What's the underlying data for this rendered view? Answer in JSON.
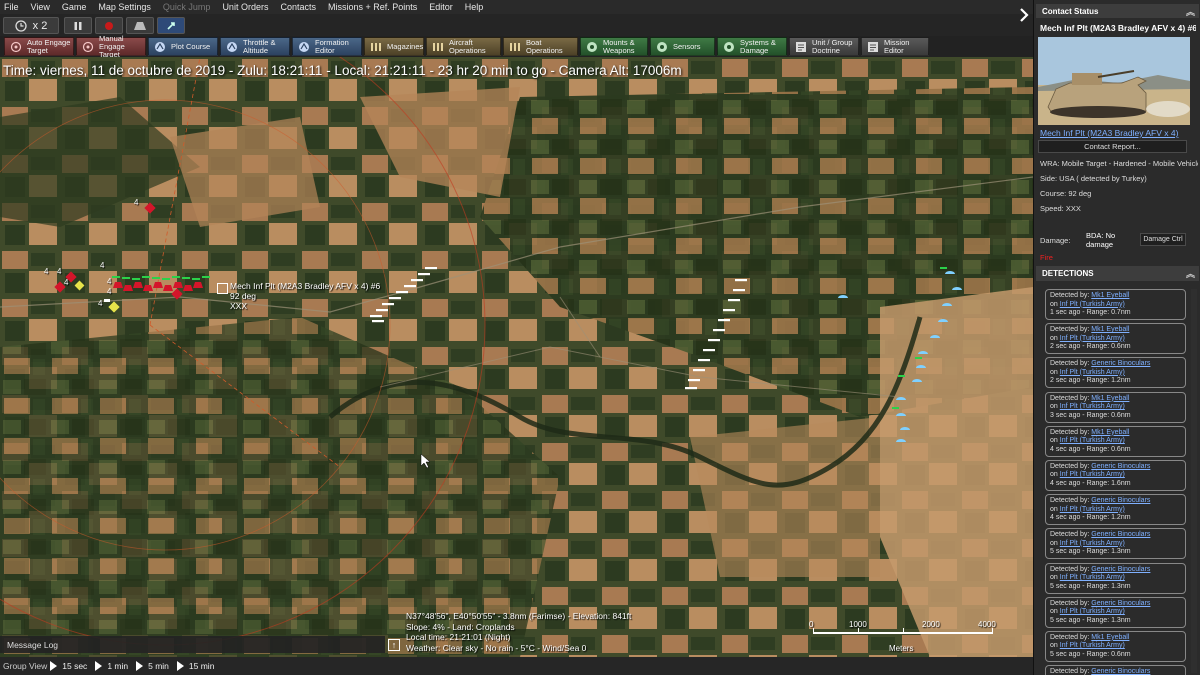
{
  "menu": {
    "items": [
      "File",
      "View",
      "Game",
      "Map Settings",
      "Quick Jump",
      "Unit Orders",
      "Contacts",
      "Missions + Ref. Points",
      "Editor",
      "Help"
    ],
    "disabled_index": 4
  },
  "time_controls": {
    "speed_label": "x 2"
  },
  "toolbar": [
    {
      "label": "Auto Engage Target",
      "icon": "target-icon",
      "style": "red"
    },
    {
      "label": "Manual Engage Target",
      "icon": "crosshair-icon",
      "style": "red"
    },
    {
      "label": "Plot Course",
      "icon": "course-icon",
      "style": "blue"
    },
    {
      "label": "Throttle & Altitude",
      "icon": "throttle-icon",
      "style": "blue"
    },
    {
      "label": "Formation Editor",
      "icon": "formation-icon",
      "style": "blue"
    },
    {
      "label": "Magazines",
      "icon": "ammo-icon",
      "style": "brown"
    },
    {
      "label": "Aircraft Operations",
      "icon": "aircraft-icon",
      "style": "brown"
    },
    {
      "label": "Boat Operations",
      "icon": "boat-icon",
      "style": "brown"
    },
    {
      "label": "Mounts & Weapons",
      "icon": "gun-icon",
      "style": "green"
    },
    {
      "label": "Sensors",
      "icon": "radar-icon",
      "style": "green"
    },
    {
      "label": "Systems & Damage",
      "icon": "cog-icon",
      "style": "green"
    },
    {
      "label": "Unit / Group Doctrine",
      "icon": "doctrine-icon",
      "style": "gray"
    },
    {
      "label": "Mission Editor",
      "icon": "mission-icon",
      "style": "gray"
    }
  ],
  "map": {
    "status_line": "Time: viernes, 11 de octubre de 2019 - Zulu: 18:21:11 - Local: 21:21:11 - 23 hr 20 min to go -  Camera Alt: 17006m",
    "selected_unit": {
      "name": "Mech Inf Plt (M2A3 Bradley AFV x 4) #6",
      "course": "92 deg",
      "speed": "XXX"
    },
    "unit_count_labels": [
      "4",
      "4",
      "4",
      "4",
      "4",
      "4",
      "4",
      "4"
    ],
    "cursor_info": [
      "N37°48'56\", E40°50'55\" - 3.8nm (Farimse) - Elevation: 841ft",
      "Slope: 4% - Land: Croplands",
      "Local time: 21:21:01 (Night)",
      "Weather: Clear sky - No rain - 5°C - Wind/Sea 0"
    ],
    "scale": {
      "ticks": [
        "0",
        "1000",
        "2000",
        "4000"
      ],
      "unit": "Meters"
    },
    "message_log_label": "Message Log",
    "expand_label": "↑"
  },
  "bottom_bar": {
    "label": "Group View",
    "steps": [
      "15 sec",
      "1 min",
      "5 min",
      "15 min"
    ]
  },
  "contact_panel": {
    "header": "Contact Status",
    "title": "Mech Inf Plt (M2A3 Bradley AFV x 4) #6",
    "link": "Mech Inf Plt (M2A3 Bradley AFV x 4)",
    "report_button": "Contact Report...",
    "wra": "WRA: Mobile Target - Hardened - Mobile Vehicle(s)",
    "side": "Side: USA ( detected by Turkey)",
    "course": "Course: 92 deg",
    "speed": "Speed: XXX",
    "damage_label": "Damage:",
    "bda": "BDA: No damage",
    "damage_button": "Damage Ctrl",
    "fire": "Fire"
  },
  "detections": {
    "header": "DETECTIONS",
    "items": [
      {
        "by_prefix": "Detected by:",
        "sensor": "Mk1 Eyeball",
        "on_prefix": "on",
        "unit": "Inf Plt (Turkish Army)",
        "time_range": "1 sec ago  - Range: 0.7nm"
      },
      {
        "by_prefix": "Detected by:",
        "sensor": "Mk1 Eyeball",
        "on_prefix": "on",
        "unit": "Inf Plt (Turkish Army)",
        "time_range": "2 sec ago  - Range: 0.6nm"
      },
      {
        "by_prefix": "Detected by:",
        "sensor": "Generic Binoculars",
        "on_prefix": "on",
        "unit": "Inf Plt (Turkish Army)",
        "time_range": "2 sec ago  - Range: 1.2nm"
      },
      {
        "by_prefix": "Detected by:",
        "sensor": "Mk1 Eyeball",
        "on_prefix": "on",
        "unit": "Inf Plt (Turkish Army)",
        "time_range": "3 sec ago  - Range: 0.6nm"
      },
      {
        "by_prefix": "Detected by:",
        "sensor": "Mk1 Eyeball",
        "on_prefix": "on",
        "unit": "Inf Plt (Turkish Army)",
        "time_range": "4 sec ago  - Range: 0.6nm"
      },
      {
        "by_prefix": "Detected by:",
        "sensor": "Generic Binoculars",
        "on_prefix": "on",
        "unit": "Inf Plt (Turkish Army)",
        "time_range": "4 sec ago  - Range: 1.6nm"
      },
      {
        "by_prefix": "Detected by:",
        "sensor": "Generic Binoculars",
        "on_prefix": "on",
        "unit": "Inf Plt (Turkish Army)",
        "time_range": "4 sec ago  - Range: 1.2nm"
      },
      {
        "by_prefix": "Detected by:",
        "sensor": "Generic Binoculars",
        "on_prefix": "on",
        "unit": "Inf Plt (Turkish Army)",
        "time_range": "5 sec ago  - Range: 1.3nm"
      },
      {
        "by_prefix": "Detected by:",
        "sensor": "Generic Binoculars",
        "on_prefix": "on",
        "unit": "Inf Plt (Turkish Army)",
        "time_range": "5 sec ago  - Range: 1.3nm"
      },
      {
        "by_prefix": "Detected by:",
        "sensor": "Generic Binoculars",
        "on_prefix": "on",
        "unit": "Inf Plt (Turkish Army)",
        "time_range": "5 sec ago  - Range: 1.3nm"
      },
      {
        "by_prefix": "Detected by:",
        "sensor": "Mk1 Eyeball",
        "on_prefix": "on",
        "unit": "Inf Plt (Turkish Army)",
        "time_range": "5 sec ago  - Range: 0.6nm"
      },
      {
        "by_prefix": "Detected by:",
        "sensor": "Generic Binoculars",
        "on_prefix": "on",
        "unit": "",
        "time_range": ""
      }
    ]
  },
  "colors": {
    "hostile": "#d4152a",
    "friendly": "#7fd0ff",
    "contact": "#ffffff",
    "link": "#7fb0ff"
  }
}
